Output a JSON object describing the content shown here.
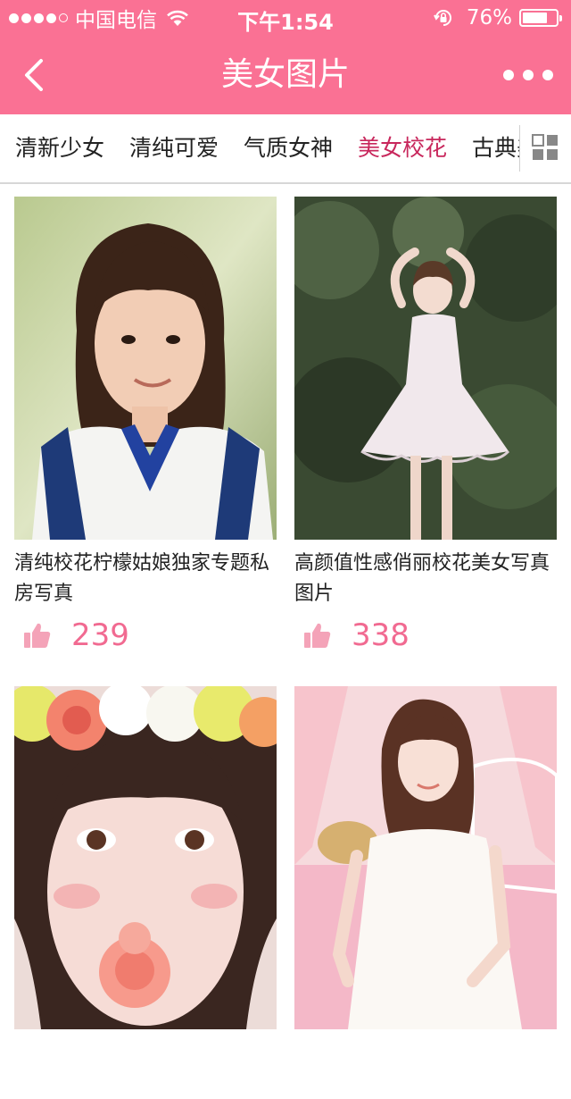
{
  "status_bar": {
    "carrier": "中国电信",
    "time": "下午1:54",
    "battery_percent": "76%",
    "battery_level": 0.76,
    "signal_bars_filled": 4,
    "signal_bars_total": 5
  },
  "nav": {
    "title": "美女图片",
    "back_icon": "chevron-left-icon",
    "more_icon": "more-dots-icon"
  },
  "tabs": {
    "items": [
      {
        "label": "清新少女",
        "active": false
      },
      {
        "label": "清纯可爱",
        "active": false
      },
      {
        "label": "气质女神",
        "active": false
      },
      {
        "label": "美女校花",
        "active": true
      },
      {
        "label": "古典美女",
        "active": false
      }
    ],
    "grid_icon": "grid-icon"
  },
  "cards": [
    {
      "title": "清纯校花柠檬姑娘独家专题私房写真",
      "likes": "239"
    },
    {
      "title": "高颜值性感俏丽校花美女写真图片",
      "likes": "338"
    },
    {
      "title": "",
      "likes": ""
    },
    {
      "title": "",
      "likes": ""
    }
  ],
  "colors": {
    "brand_pink": "#fa7194",
    "active_tab": "#c8275c",
    "like_pink": "#f16a91"
  }
}
